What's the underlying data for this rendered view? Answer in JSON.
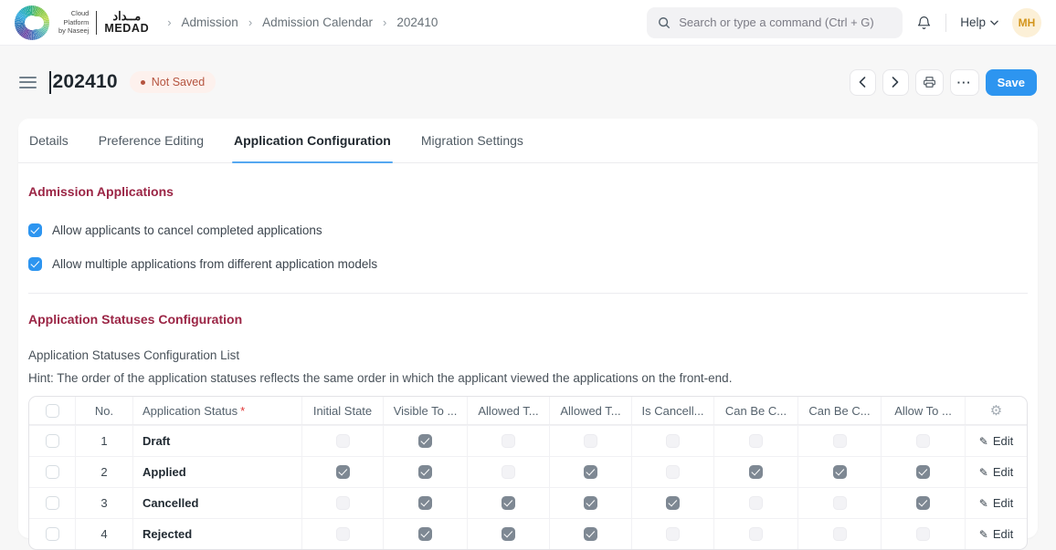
{
  "colors": {
    "accent": "#2d95f0",
    "section_heading": "#9b2545",
    "badge_bg": "#fdf1ed",
    "badge_text": "#b5543f",
    "avatar_bg": "#fcf0d7",
    "avatar_text": "#d3951c"
  },
  "icons": {
    "breadcrumb_separator": "›",
    "ellipsis": "···",
    "gear": "⚙",
    "pencil": "✎"
  },
  "navbar": {
    "brand": {
      "line1": "Cloud",
      "line2": "Platform",
      "line3": "by Naseej",
      "arabic": "مــداد",
      "name": "MEDAD"
    },
    "breadcrumbs": [
      "Admission",
      "Admission Calendar",
      "202410"
    ],
    "search": {
      "placeholder": "Search or type a command (Ctrl + G)"
    },
    "help_label": "Help",
    "avatar_initials": "MH"
  },
  "page_head": {
    "title": "202410",
    "status_badge": "Not Saved",
    "save_label": "Save"
  },
  "tabs": [
    {
      "label": "Details",
      "active": false
    },
    {
      "label": "Preference Editing",
      "active": false
    },
    {
      "label": "Application Configuration",
      "active": true
    },
    {
      "label": "Migration Settings",
      "active": false
    }
  ],
  "admission_applications": {
    "heading": "Admission Applications",
    "checkboxes": [
      {
        "label": "Allow applicants to cancel completed applications",
        "checked": true
      },
      {
        "label": "Allow multiple applications from different application models",
        "checked": true
      }
    ]
  },
  "statuses_config": {
    "heading": "Application Statuses Configuration",
    "list_label": "Application Statuses Configuration List",
    "hint": "Hint: The order of the application statuses reflects the same order in which the applicant viewed the applications on the front-end.",
    "table": {
      "columns": [
        {
          "label": "No.",
          "required": false
        },
        {
          "label": "Application Status",
          "required": true
        },
        {
          "label": "Initial State",
          "required": false
        },
        {
          "label": "Visible To ...",
          "required": false
        },
        {
          "label": "Allowed T...",
          "required": false
        },
        {
          "label": "Allowed T...",
          "required": false
        },
        {
          "label": "Is Cancell...",
          "required": false
        },
        {
          "label": "Can Be C...",
          "required": false
        },
        {
          "label": "Can Be C...",
          "required": false
        },
        {
          "label": "Allow To ...",
          "required": false
        }
      ],
      "edit_label": "Edit",
      "rows": [
        {
          "no": "1",
          "status": "Draft",
          "checks": [
            false,
            true,
            false,
            false,
            false,
            false,
            false,
            false
          ]
        },
        {
          "no": "2",
          "status": "Applied",
          "checks": [
            true,
            true,
            false,
            true,
            false,
            true,
            true,
            true
          ]
        },
        {
          "no": "3",
          "status": "Cancelled",
          "checks": [
            false,
            true,
            true,
            true,
            true,
            false,
            false,
            true
          ]
        },
        {
          "no": "4",
          "status": "Rejected",
          "checks": [
            false,
            true,
            true,
            true,
            false,
            false,
            false,
            false
          ]
        }
      ]
    }
  }
}
